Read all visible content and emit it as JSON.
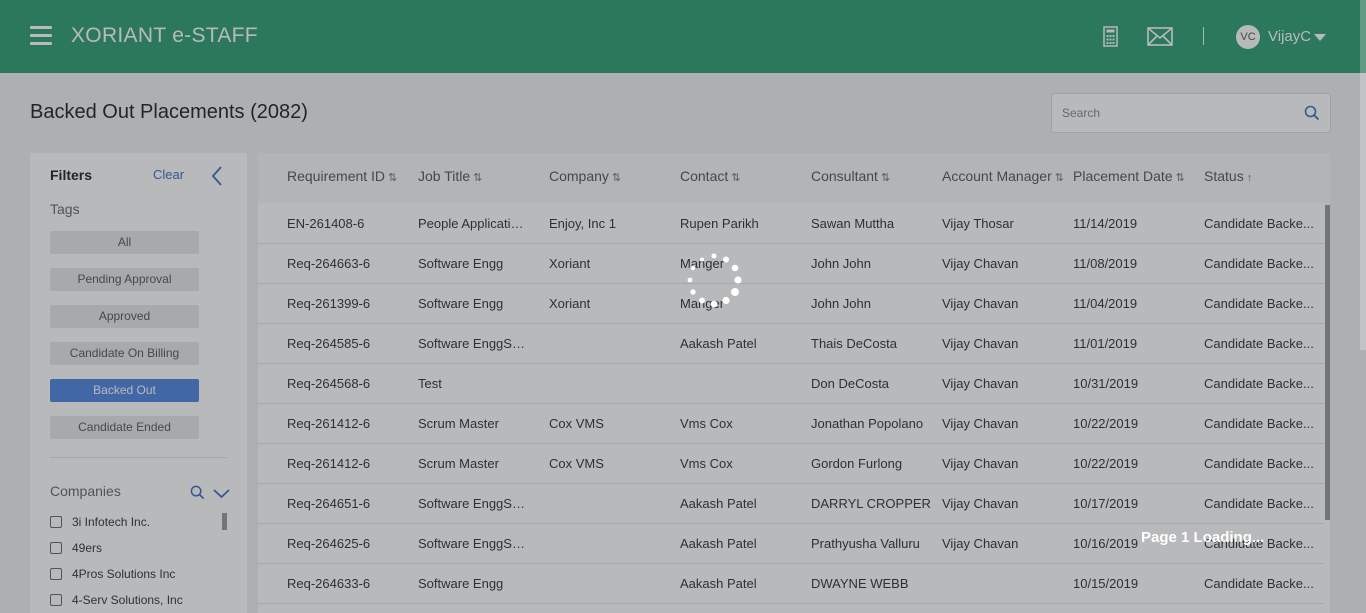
{
  "header": {
    "app_title": "XORIANT e-STAFF",
    "icons": [
      "menu-icon",
      "calculator-icon",
      "mail-icon",
      "chevron-down-icon"
    ],
    "user": {
      "initials": "VC",
      "name": "VijayC"
    },
    "bg_color": "#2f9e73"
  },
  "page": {
    "title": "Backed Out Placements (2082)",
    "search_placeholder": "Search"
  },
  "filters": {
    "title": "Filters",
    "clear_label": "Clear",
    "tags_label": "Tags",
    "tags": [
      {
        "label": "All",
        "active": false
      },
      {
        "label": "Pending Approval",
        "active": false
      },
      {
        "label": "Approved",
        "active": false
      },
      {
        "label": "Candidate On Billing",
        "active": false
      },
      {
        "label": "Backed Out",
        "active": true
      },
      {
        "label": "Candidate Ended",
        "active": false
      }
    ],
    "companies_label": "Companies",
    "companies": [
      "3i Infotech Inc.",
      "49ers",
      "4Pros Solutions Inc",
      "4-Serv Solutions, Inc"
    ]
  },
  "table": {
    "columns": [
      {
        "label": "Requirement ID",
        "sort": "⇅"
      },
      {
        "label": "Job Title",
        "sort": "⇅"
      },
      {
        "label": "Company",
        "sort": "⇅"
      },
      {
        "label": "Contact",
        "sort": "⇅"
      },
      {
        "label": "Consultant",
        "sort": "⇅"
      },
      {
        "label": "Account Manager",
        "sort": "⇅"
      },
      {
        "label": "Placement Date",
        "sort": "⇅"
      },
      {
        "label": "Status",
        "sort": "↑"
      }
    ],
    "rows": [
      [
        "EN-261408-6",
        "People Applicatio...",
        "Enjoy, Inc 1",
        "Rupen Parikh",
        "Sawan Muttha",
        "Vijay Thosar",
        "11/14/2019",
        "Candidate Backe..."
      ],
      [
        "Req-264663-6",
        "Software Engg",
        "Xoriant",
        "Manger",
        "John John",
        "Vijay Chavan",
        "11/08/2019",
        "Candidate Backe..."
      ],
      [
        "Req-261399-6",
        "Software Engg",
        "Xoriant",
        "Manger",
        "John John",
        "Vijay Chavan",
        "11/04/2019",
        "Candidate Backe..."
      ],
      [
        "Req-264585-6",
        "Software EnggSo...",
        "",
        "Aakash Patel",
        "Thais DeCosta",
        "Vijay Chavan",
        "11/01/2019",
        "Candidate Backe..."
      ],
      [
        "Req-264568-6",
        "Test",
        "",
        "",
        "Don DeCosta",
        "Vijay Chavan",
        "10/31/2019",
        "Candidate Backe..."
      ],
      [
        "Req-261412-6",
        "Scrum Master",
        "Cox VMS",
        "Vms Cox",
        "Jonathan Popolano",
        "Vijay Chavan",
        "10/22/2019",
        "Candidate Backe..."
      ],
      [
        "Req-261412-6",
        "Scrum Master",
        "Cox VMS",
        "Vms Cox",
        "Gordon Furlong",
        "Vijay Chavan",
        "10/22/2019",
        "Candidate Backe..."
      ],
      [
        "Req-264651-6",
        "Software EnggSo...",
        "",
        "Aakash Patel",
        "DARRYL CROPPER",
        "Vijay Chavan",
        "10/17/2019",
        "Candidate Backe..."
      ],
      [
        "Req-264625-6",
        "Software EnggSo...",
        "",
        "Aakash Patel",
        "Prathyusha Valluru",
        "Vijay Chavan",
        "10/16/2019",
        "Candidate Backe..."
      ],
      [
        "Req-264633-6",
        "Software Engg",
        "",
        "Aakash Patel",
        "DWAYNE WEBB",
        "",
        "10/15/2019",
        "Candidate Backe..."
      ]
    ]
  },
  "loading": {
    "text": "Page 1 Loading..."
  }
}
